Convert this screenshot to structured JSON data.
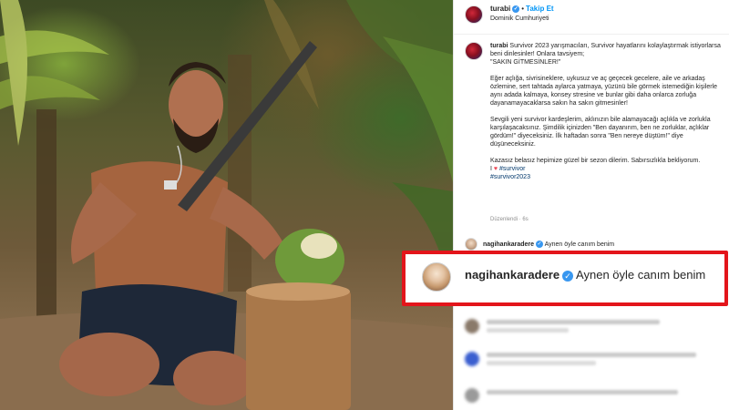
{
  "post": {
    "username": "turabi",
    "follow_label": "Takip Et",
    "location": "Dominik Cumhuriyeti",
    "caption": {
      "lines": [
        "Survivor 2023 yarışmacıları, Survivor hayatlarını kolaylaştırmak istiyorlarsa beni dinlesinler! Onlara tavsiyem;",
        "\"SAKIN GİTMESİNLER!\"",
        "Eğer açlığa, sivrisineklere, uykusuz ve aç geçecek gecelere, aile ve arkadaş özlemine, sert tahtada aylarca yatmaya, yüzünü bile görmek istemediğin kişilerle aynı adada kalmaya, konsey stresine ve bunlar gibi daha onlarca zorluğa dayanamayacaklarsa sakın ha sakın gitmesinler!",
        "Sevgili yeni survivor kardeşlerim, aklınızın bile alamayacağı açlıkla ve zorlukla karşılaşacaksınız. Şimdilik içinizden \"Ben dayanırım, ben ne zorluklar, açlıklar gördüm!\" diyeceksiniz. İlk haftadan sonra \"Ben nereye düştüm!\" diye düşüneceksiniz.",
        "Kazasız belasız hepimize güzel bir sezon dilerim. Sabırsızlıkla bekliyorum.",
        "I",
        "#survivor",
        "#survivor2023"
      ]
    },
    "edited_label": "Düzenlendi · 6s"
  },
  "comments": [
    {
      "username": "nagihankaradere",
      "text": "Aynen öyle canım benim"
    }
  ],
  "highlight": {
    "username": "nagihankaradere",
    "text": "Aynen öyle canım benim",
    "border_color": "#e3151b"
  },
  "icons": {
    "verified": "verified-badge-icon",
    "heart": "heart-icon"
  },
  "colors": {
    "link": "#0095f6",
    "hashtag": "#00376b",
    "verified": "#3897f0"
  }
}
